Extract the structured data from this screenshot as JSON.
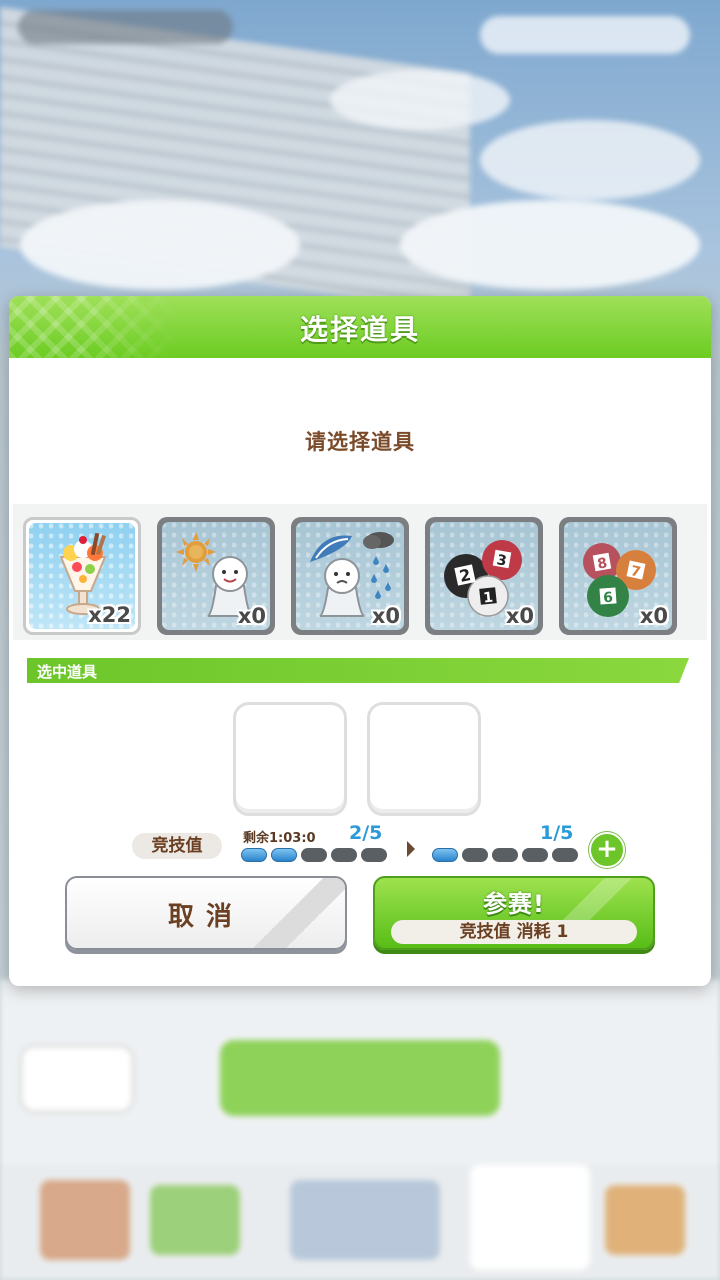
{
  "dialog": {
    "title": "选择道具",
    "prompt": "请选择道具",
    "selected_section_label": "选中道具"
  },
  "items": [
    {
      "name": "parfait",
      "icon": "parfait-icon",
      "qty": "x22",
      "selected": true
    },
    {
      "name": "sunny-teru-teru",
      "icon": "sun-doll-icon",
      "qty": "x0",
      "selected": false
    },
    {
      "name": "rainy-teru-teru",
      "icon": "rain-doll-icon",
      "qty": "x0",
      "selected": false
    },
    {
      "name": "lottery-balls-123",
      "icon": "balls-123-icon",
      "qty": "x0",
      "selected": false
    },
    {
      "name": "lottery-balls-678",
      "icon": "balls-678-icon",
      "qty": "x0",
      "selected": false
    }
  ],
  "stats": {
    "label": "竞技值",
    "remaining": "剩余1:03:0",
    "current": "2/5",
    "after": "1/5",
    "current_filled": 2,
    "after_filled": 1,
    "max": 5
  },
  "buttons": {
    "cancel_label": "取消",
    "join_label": "参赛!",
    "join_cost": "竞技值 消耗 1"
  },
  "colors": {
    "accent_green": "#6ccc22",
    "text_brown": "#6b3f22",
    "stat_blue": "#2a9ad8"
  }
}
